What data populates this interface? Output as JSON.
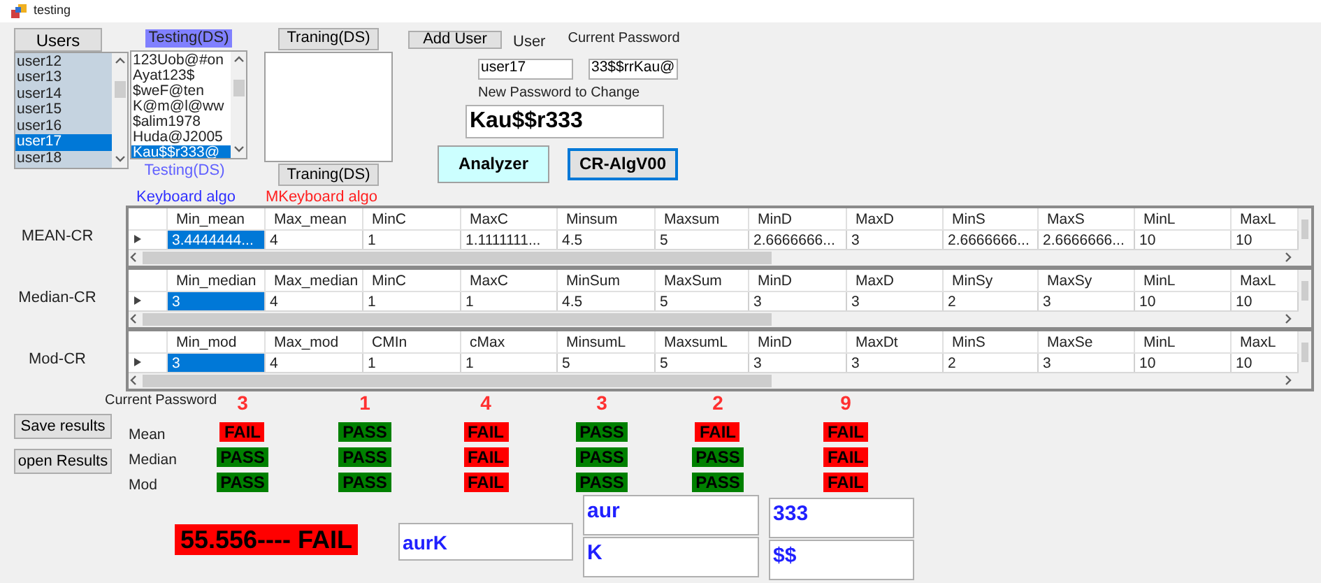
{
  "window": {
    "title": "testing"
  },
  "users": {
    "header": "Users",
    "items": [
      {
        "text": "user12",
        "selected": false
      },
      {
        "text": "user13",
        "selected": false
      },
      {
        "text": "user14",
        "selected": false
      },
      {
        "text": "user15",
        "selected": false
      },
      {
        "text": "user16",
        "selected": false
      },
      {
        "text": "user17",
        "selected": true
      },
      {
        "text": "user18",
        "selected": false
      }
    ]
  },
  "testing": {
    "title": "Testing(DS)",
    "items": [
      {
        "text": "123Uob@#on",
        "selected": false
      },
      {
        "text": "Ayat123$",
        "selected": false
      },
      {
        "text": "$weF@ten",
        "selected": false
      },
      {
        "text": "K@m@l@ww",
        "selected": false
      },
      {
        "text": "$alim1978",
        "selected": false
      },
      {
        "text": "Huda@J2005",
        "selected": false
      },
      {
        "text": "Kau$$r333@",
        "selected": true
      }
    ],
    "caption": "Testing(DS)",
    "algo": "Keyboard algo"
  },
  "training": {
    "button": "Traning(DS)",
    "button_2": "Traning(DS)",
    "algo": "MKeyboard algo"
  },
  "user_form": {
    "add_button": "Add User",
    "user_label": "User",
    "user_value": "user17",
    "current_label": "Current Password",
    "current_value": "33$$rrKau@",
    "new_label": "New Password to Change",
    "new_value": "Kau$$r333",
    "buttons": [
      "Analyzer",
      "CR-AlgV00"
    ]
  },
  "grids": [
    {
      "label": "MEAN-CR",
      "columns": [
        "Min_mean",
        "Max_mean",
        "MinC",
        "MaxC",
        "Minsum",
        "Maxsum",
        "MinD",
        "MaxD",
        "MinS",
        "MaxS",
        "MinL",
        "MaxL"
      ],
      "cells": [
        {
          "text": "3.4444444...",
          "selected": true
        },
        {
          "text": "4",
          "selected": false
        },
        {
          "text": "1",
          "selected": false
        },
        {
          "text": "1.1111111...",
          "selected": false
        },
        {
          "text": "4.5",
          "selected": false
        },
        {
          "text": "5",
          "selected": false
        },
        {
          "text": "2.6666666...",
          "selected": false
        },
        {
          "text": "3",
          "selected": false
        },
        {
          "text": "2.6666666...",
          "selected": false
        },
        {
          "text": "2.6666666...",
          "selected": false
        },
        {
          "text": "10",
          "selected": false
        },
        {
          "text": "10",
          "selected": false
        }
      ]
    },
    {
      "label": "Median-CR",
      "columns": [
        "Min_median",
        "Max_median",
        "MinC",
        "MaxC",
        "MinSum",
        "MaxSum",
        "MinD",
        "MaxD",
        "MinSy",
        "MaxSy",
        "MinL",
        "MaxL"
      ],
      "cells": [
        {
          "text": "3",
          "selected": true
        },
        {
          "text": "4",
          "selected": false
        },
        {
          "text": "1",
          "selected": false
        },
        {
          "text": "1",
          "selected": false
        },
        {
          "text": "4.5",
          "selected": false
        },
        {
          "text": "5",
          "selected": false
        },
        {
          "text": "3",
          "selected": false
        },
        {
          "text": "3",
          "selected": false
        },
        {
          "text": "2",
          "selected": false
        },
        {
          "text": "3",
          "selected": false
        },
        {
          "text": "10",
          "selected": false
        },
        {
          "text": "10",
          "selected": false
        }
      ]
    },
    {
      "label": "Mod-CR",
      "columns": [
        "Min_mod",
        "Max_mod",
        "CMIn",
        "cMax",
        "MinsumL",
        "MaxsumL",
        "MinD",
        "MaxDt",
        "MinS",
        "MaxSe",
        "MinL",
        "MaxL"
      ],
      "cells": [
        {
          "text": "3",
          "selected": true
        },
        {
          "text": "4",
          "selected": false
        },
        {
          "text": "1",
          "selected": false
        },
        {
          "text": "1",
          "selected": false
        },
        {
          "text": "5",
          "selected": false
        },
        {
          "text": "5",
          "selected": false
        },
        {
          "text": "3",
          "selected": false
        },
        {
          "text": "3",
          "selected": false
        },
        {
          "text": "2",
          "selected": false
        },
        {
          "text": "3",
          "selected": false
        },
        {
          "text": "10",
          "selected": false
        },
        {
          "text": "10",
          "selected": false
        }
      ]
    }
  ],
  "results": {
    "label": "Current Password",
    "buttons": [
      "Save results",
      "open Results"
    ],
    "row_labels": [
      "Mean",
      "Median",
      "Mod"
    ],
    "columns": [
      {
        "count": "3",
        "statuses": [
          {
            "text": "FAIL",
            "passed": false
          },
          {
            "text": "PASS",
            "passed": true
          },
          {
            "text": "PASS",
            "passed": true
          }
        ]
      },
      {
        "count": "1",
        "statuses": [
          {
            "text": "PASS",
            "passed": true
          },
          {
            "text": "PASS",
            "passed": true
          },
          {
            "text": "PASS",
            "passed": true
          }
        ]
      },
      {
        "count": "4",
        "statuses": [
          {
            "text": "FAIL",
            "passed": false
          },
          {
            "text": "FAIL",
            "passed": false
          },
          {
            "text": "FAIL",
            "passed": false
          }
        ]
      },
      {
        "count": "3",
        "statuses": [
          {
            "text": "PASS",
            "passed": true
          },
          {
            "text": "PASS",
            "passed": true
          },
          {
            "text": "PASS",
            "passed": true
          }
        ]
      },
      {
        "count": "2",
        "statuses": [
          {
            "text": "FAIL",
            "passed": false
          },
          {
            "text": "PASS",
            "passed": true
          },
          {
            "text": "PASS",
            "passed": true
          }
        ]
      },
      {
        "count": "9",
        "statuses": [
          {
            "text": "FAIL",
            "passed": false
          },
          {
            "text": "FAIL",
            "passed": false
          },
          {
            "text": "FAIL",
            "passed": false
          }
        ]
      }
    ]
  },
  "score": {
    "text": "55.556---- FAIL",
    "passed": false
  },
  "output_fields": {
    "joined": "aurK",
    "pair_1": [
      "aur",
      "K"
    ],
    "pair_2": [
      "333",
      "$$"
    ]
  }
}
